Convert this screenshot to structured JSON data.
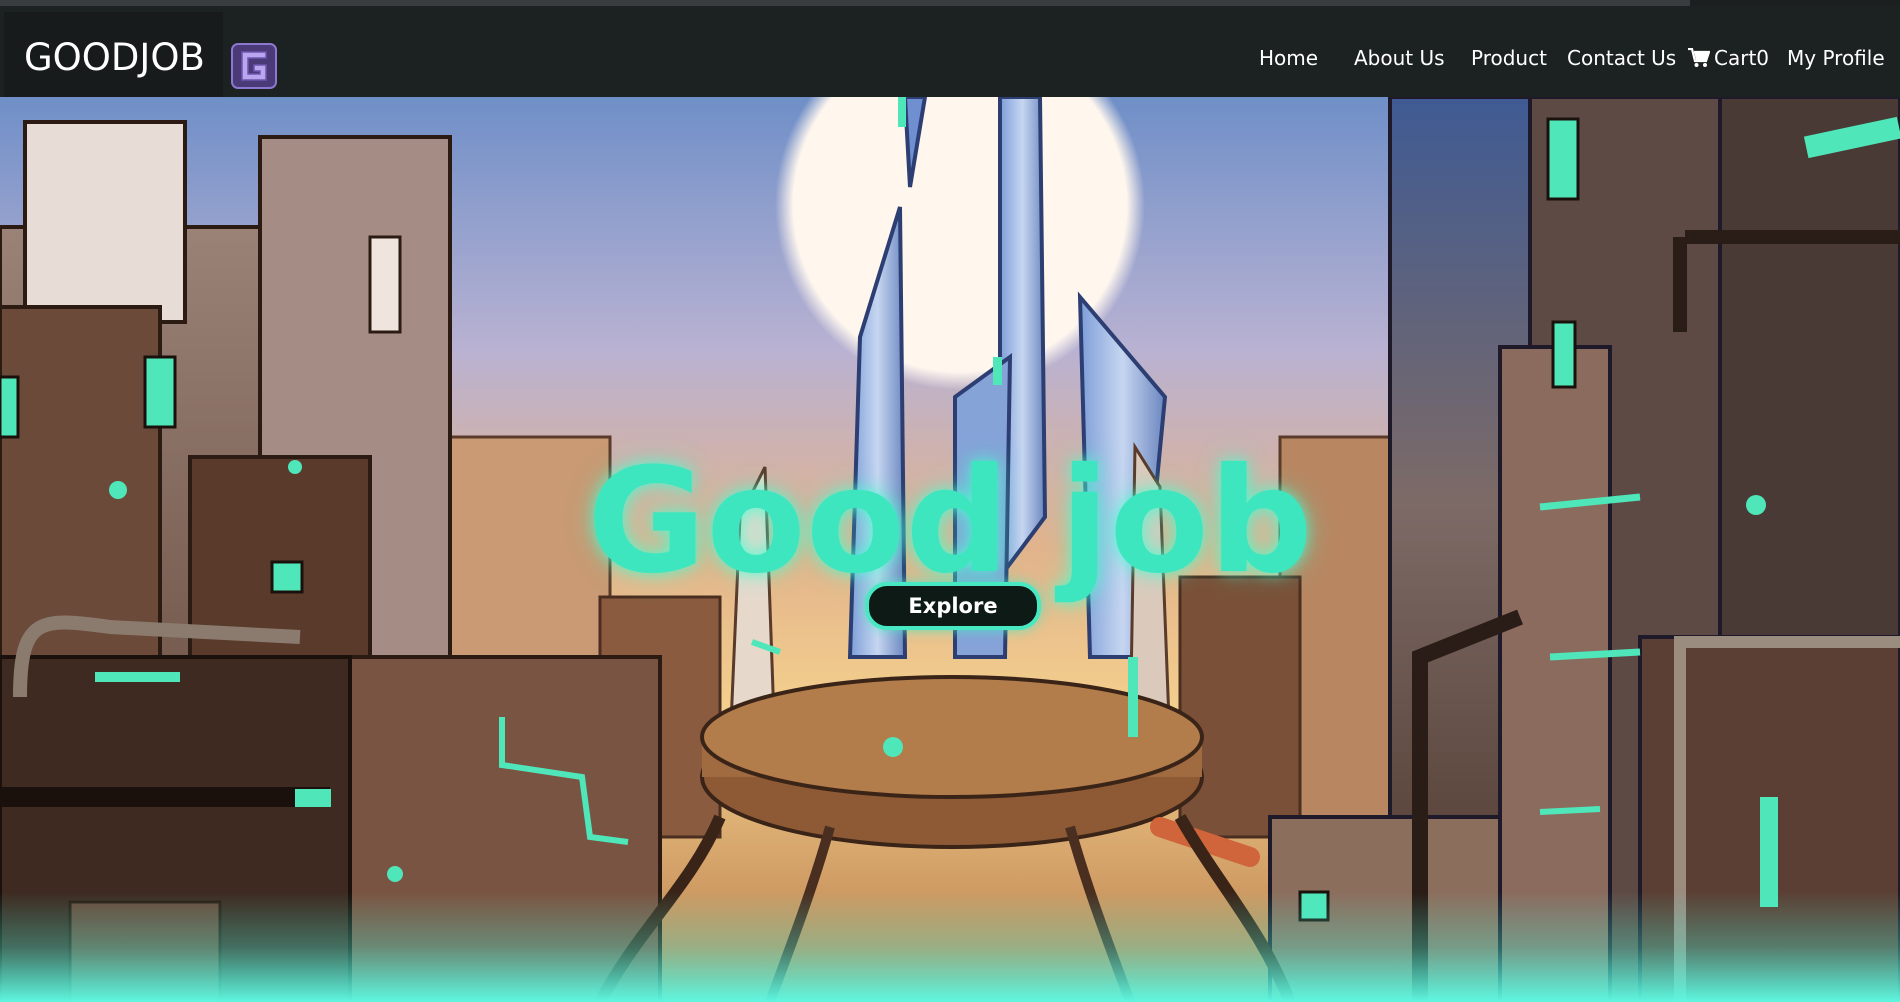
{
  "navbar": {
    "brand": "GOODJOB",
    "logo_icon": "goodjob-logo-icon",
    "links": {
      "home": "Home",
      "about": "About Us",
      "product": "Product",
      "contact": "Contact Us",
      "cart": "Cart0",
      "profile": "My Profile"
    },
    "cart_icon": "shopping-cart-icon"
  },
  "hero": {
    "title": "Good job",
    "button": "Explore",
    "accent_color": "#3ee6bf",
    "background": "futuristic-city-illustration"
  }
}
